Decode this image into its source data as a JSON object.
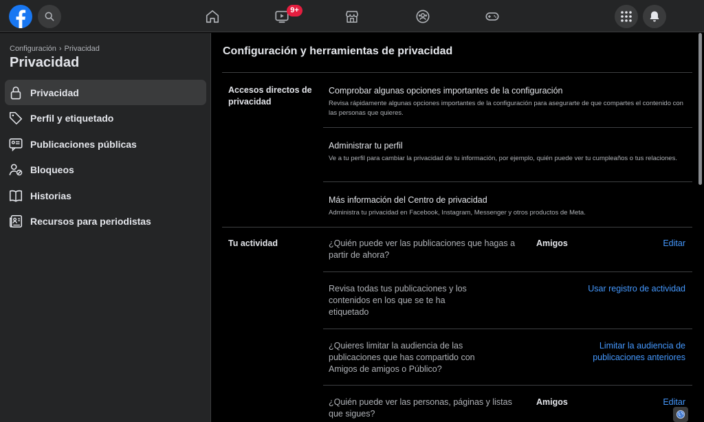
{
  "topbar": {
    "badge": "9+",
    "icons": [
      "facebook-logo",
      "search-icon",
      "home-icon",
      "video-icon",
      "marketplace-icon",
      "groups-icon",
      "gaming-icon",
      "menu-grid-icon",
      "notifications-icon"
    ]
  },
  "sidebar": {
    "breadcrumb_parent": "Configuración",
    "breadcrumb_separator": "›",
    "breadcrumb_current": "Privacidad",
    "title": "Privacidad",
    "items": [
      {
        "label": "Privacidad",
        "icon": "lock-icon"
      },
      {
        "label": "Perfil y etiquetado",
        "icon": "tag-icon"
      },
      {
        "label": "Publicaciones públicas",
        "icon": "public-posts-icon"
      },
      {
        "label": "Bloqueos",
        "icon": "block-user-icon"
      },
      {
        "label": "Historias",
        "icon": "book-icon"
      },
      {
        "label": "Recursos para periodistas",
        "icon": "news-icon"
      }
    ]
  },
  "main": {
    "title": "Configuración y herramientas de privacidad",
    "shortcuts": {
      "label": "Accesos directos de privacidad",
      "items": [
        {
          "title": "Comprobar algunas opciones importantes de la configuración",
          "desc": "Revisa rápidamente algunas opciones importantes de la configuración para asegurarte de que compartes el contenido con las personas que quieres."
        },
        {
          "title": "Administrar tu perfil",
          "desc": "Ve a tu perfil para cambiar la privacidad de tu información, por ejemplo, quién puede ver tu cumpleaños o tus relaciones."
        },
        {
          "title": "Más información del Centro de privacidad",
          "desc": "Administra tu privacidad en Facebook, Instagram, Messenger y otros productos de Meta."
        }
      ]
    },
    "activity": {
      "label": "Tu actividad",
      "rows": [
        {
          "question": "¿Quién puede ver las publicaciones que hagas a partir de ahora?",
          "value": "Amigos",
          "action": "Editar"
        },
        {
          "question": "Revisa todas tus publicaciones y los contenidos en los que se te ha etiquetado",
          "value": "",
          "action": "Usar registro de actividad"
        },
        {
          "question": "¿Quieres limitar la audiencia de las publicaciones que has compartido con Amigos de amigos o Público?",
          "value": "",
          "action": "Limitar la audiencia de publicaciones anteriores"
        },
        {
          "question": "¿Quién puede ver las personas, páginas y listas que sigues?",
          "value": "Amigos",
          "action": "Editar"
        }
      ]
    }
  },
  "colors": {
    "accent": "#1877f2",
    "link": "#4599ff",
    "badge": "#e41e3f",
    "surface": "#242526",
    "background": "#000000"
  }
}
